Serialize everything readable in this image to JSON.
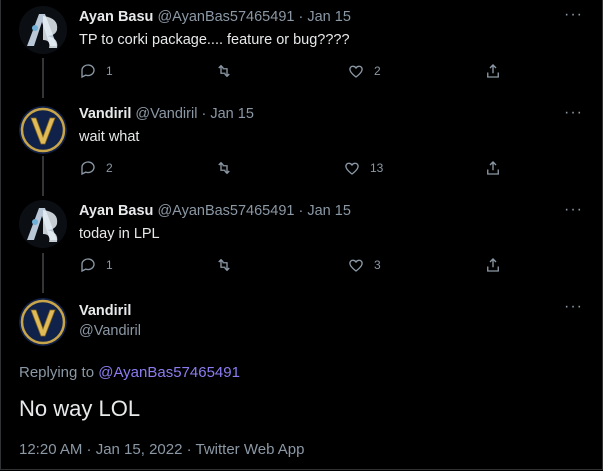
{
  "tweets": [
    {
      "name": "Ayan Basu",
      "handle": "@AyanBas57465491",
      "date": "Jan 15",
      "text": "TP to corki package.... feature or bug????",
      "replies": "1",
      "retweets": "",
      "likes": "2",
      "avatar": "ab-logo-avatar"
    },
    {
      "name": "Vandiril",
      "handle": "@Vandiril",
      "date": "Jan 15",
      "text": "wait what",
      "replies": "2",
      "retweets": "",
      "likes": "13",
      "avatar": "v-logo-avatar"
    },
    {
      "name": "Ayan Basu",
      "handle": "@AyanBas57465491",
      "date": "Jan 15",
      "text": "today in LPL",
      "replies": "1",
      "retweets": "",
      "likes": "3",
      "avatar": "ab-logo-avatar"
    }
  ],
  "main": {
    "name": "Vandiril",
    "handle": "@Vandiril",
    "replying_prefix": "Replying to ",
    "replying_to": "@AyanBas57465491",
    "text": "No way LOL",
    "meta": "12:20 AM · Jan 15, 2022 · Twitter Web App"
  },
  "ui": {
    "separator": "·",
    "more": "···"
  },
  "colors": {
    "background": "#000000",
    "mention": "#8b7df0",
    "muted": "#8b98a5"
  }
}
